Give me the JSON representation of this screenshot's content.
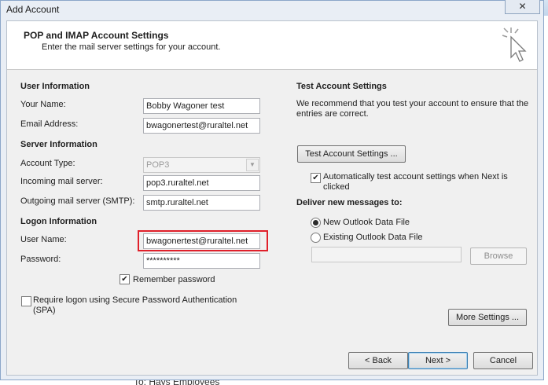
{
  "window": {
    "title": "Add Account",
    "close_symbol": "✕"
  },
  "background": {
    "bottom_text": "To: Hays Employees"
  },
  "header": {
    "title": "POP and IMAP Account Settings",
    "subtitle": "Enter the mail server settings for your account.",
    "icon": "cursor-click-icon"
  },
  "user_info": {
    "heading": "User Information",
    "name_label": "Your Name:",
    "name_value": "Bobby Wagoner test",
    "email_label": "Email Address:",
    "email_value": "bwagonertest@ruraltel.net"
  },
  "server_info": {
    "heading": "Server Information",
    "account_type_label": "Account Type:",
    "account_type_value": "POP3",
    "incoming_label": "Incoming mail server:",
    "incoming_value": "pop3.ruraltel.net",
    "outgoing_label": "Outgoing mail server (SMTP):",
    "outgoing_value": "smtp.ruraltel.net"
  },
  "logon_info": {
    "heading": "Logon Information",
    "username_label": "User Name:",
    "username_value": "bwagonertest@ruraltel.net",
    "password_label": "Password:",
    "password_value": "**********",
    "remember_label": "Remember password",
    "remember_checked": true,
    "spa_label": "Require logon using Secure Password Authentication (SPA)",
    "spa_checked": false
  },
  "test_settings": {
    "heading": "Test Account Settings",
    "description": "We recommend that you test your account to ensure that the entries are correct.",
    "test_button": "Test Account Settings ...",
    "auto_test_label": "Automatically test account settings when Next is clicked",
    "auto_test_checked": true
  },
  "deliver": {
    "heading": "Deliver new messages to:",
    "option_new": "New Outlook Data File",
    "option_existing": "Existing Outlook Data File",
    "selected": "new",
    "existing_path": "",
    "browse_button": "Browse"
  },
  "buttons": {
    "more_settings": "More Settings ...",
    "back": "< Back",
    "next": "Next >",
    "cancel": "Cancel"
  },
  "colors": {
    "highlight": "#e0202a",
    "dialog_bg": "#f0f0f0",
    "accent": "#3c7fb1"
  }
}
